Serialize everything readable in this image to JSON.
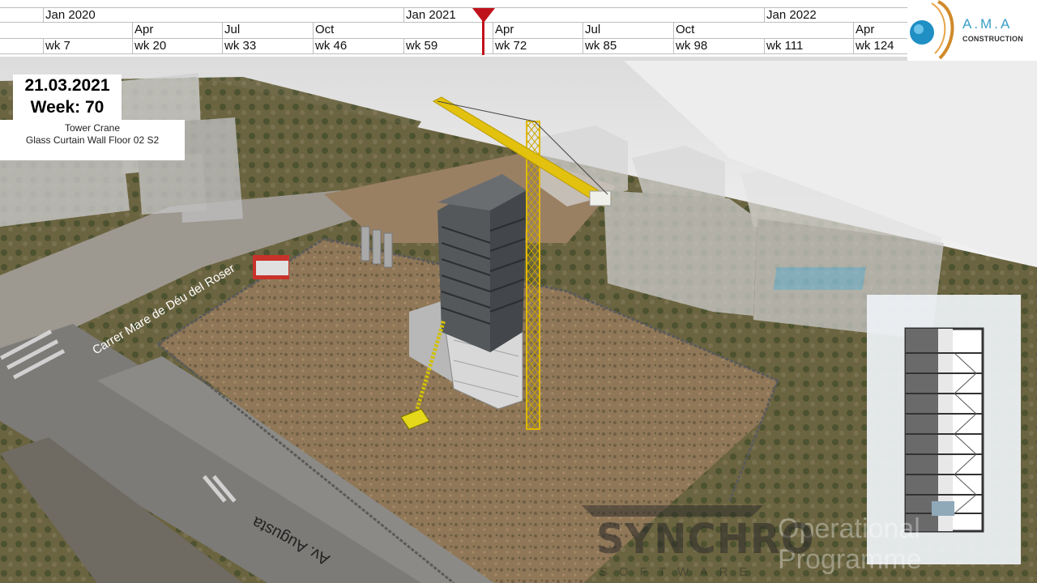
{
  "timeline": {
    "years": [
      "Jan 2020",
      "Jan 2021",
      "Jan 2022"
    ],
    "months": [
      "Apr",
      "Jul",
      "Oct",
      "Apr",
      "Jul",
      "Oct",
      "Apr"
    ],
    "weeks": [
      "wk 7",
      "wk 20",
      "wk 33",
      "wk 46",
      "wk 59",
      "wk 72",
      "wk 85",
      "wk 98",
      "wk 111",
      "wk 124"
    ],
    "marker_color": "#c0121b"
  },
  "logo": {
    "name": "A.M.A",
    "subtitle": "CONSTRUCTION",
    "brand_color": "#3a9fc8"
  },
  "status": {
    "date": "21.03.2021",
    "week": "Week: 70",
    "tasks": [
      "Tower Crane",
      "Glass Curtain Wall Floor 02 S2"
    ]
  },
  "watermark": {
    "brand": "SYNCHRO",
    "sub": "SOFTWARE",
    "ghost_lines": [
      "Operational",
      "Programme"
    ]
  },
  "street_labels": [
    "Carrer Mare de Déu del Roser",
    "Av. Augusta"
  ],
  "icons": {
    "timeline_marker": "playhead-triangle-icon",
    "logo": "ama-logo-icon"
  }
}
